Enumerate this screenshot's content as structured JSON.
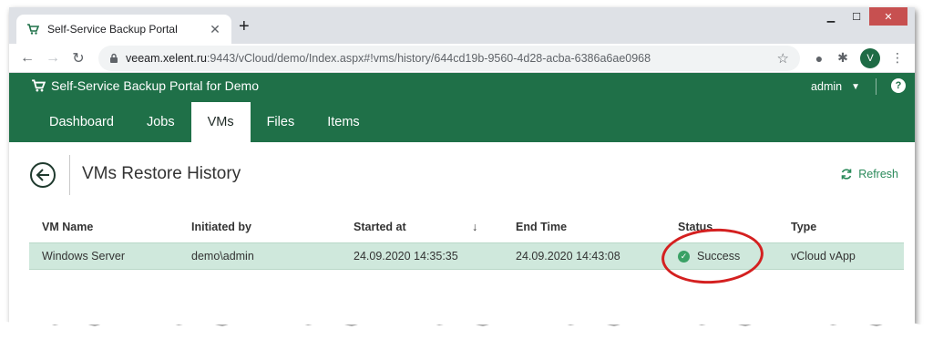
{
  "browser": {
    "tab_title": "Self-Service Backup Portal",
    "url_host": "veeam.xelent.ru",
    "url_rest": ":9443/vCloud/demo/Index.aspx#!vms/history/644cd19b-9560-4d28-acba-6386a6ae0968",
    "profile_initial": "V"
  },
  "app": {
    "title": "Self-Service Backup Portal for Demo",
    "user": "admin",
    "help_label": "?",
    "nav": [
      {
        "label": "Dashboard"
      },
      {
        "label": "Jobs"
      },
      {
        "label": "VMs",
        "active": true
      },
      {
        "label": "Files"
      },
      {
        "label": "Items"
      }
    ]
  },
  "page": {
    "title": "VMs Restore History",
    "refresh_label": "Refresh"
  },
  "table": {
    "columns": [
      "VM Name",
      "Initiated by",
      "Started at",
      "End Time",
      "Status",
      "Type"
    ],
    "sort_indicator": "↓",
    "rows": [
      {
        "vm_name": "Windows Server",
        "initiated_by": "demo\\admin",
        "started_at": "24.09.2020 14:35:35",
        "end_time": "24.09.2020 14:43:08",
        "status": "Success",
        "type": "vCloud vApp"
      }
    ]
  },
  "colors": {
    "brand_green": "#1f7048",
    "row_selected": "#cfe8dc",
    "success": "#3aa165",
    "annotation_red": "#d42020"
  }
}
